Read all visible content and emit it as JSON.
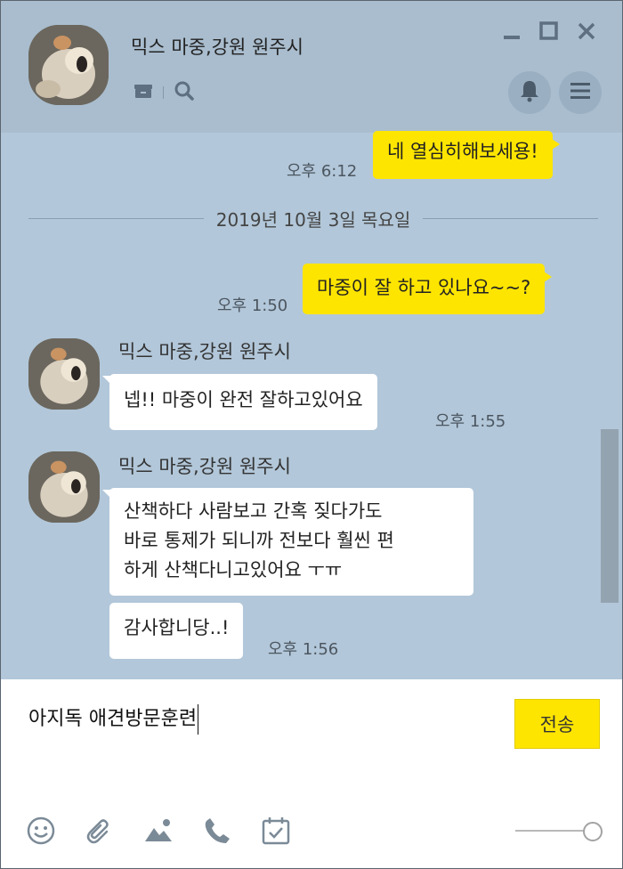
{
  "window": {
    "title": "믹스 마중,강원 원주시"
  },
  "messages": [
    {
      "type": "mine",
      "text": "네 열심히해보세용!",
      "time": "오후 6:12"
    },
    {
      "type": "date",
      "text": "2019년 10월 3일 목요일"
    },
    {
      "type": "mine",
      "text": "마중이 잘 하고 있나요~~?",
      "time": "오후 1:50"
    },
    {
      "type": "theirs",
      "sender": "믹스 마중,강원 원주시",
      "text": "넵!! 마중이 완전 잘하고있어요",
      "time": "오후 1:55"
    },
    {
      "type": "theirs",
      "sender": "믹스 마중,강원 원주시",
      "lines": [
        "산책하다 사람보고 간혹 짖다가도",
        "바로 통제가 되니까 전보다 훨씬 편",
        "하게 산책다니고있어요 ㅜㅠ"
      ]
    },
    {
      "type": "theirs",
      "text": "감사합니당..!",
      "time": "오후 1:56"
    }
  ],
  "input": {
    "value": "아지독 애견방문훈련",
    "send_label": "전송"
  },
  "icons": {
    "header": [
      "archive-icon",
      "search-icon",
      "minimize-icon",
      "maximize-icon",
      "close-icon",
      "bell-icon",
      "menu-icon"
    ],
    "toolbar": [
      "emoji-icon",
      "attachment-icon",
      "image-icon",
      "phone-icon",
      "calendar-icon"
    ]
  },
  "colors": {
    "background": "#b2c7d9",
    "my_bubble": "#fee500",
    "their_bubble": "#ffffff",
    "send_button": "#fee500"
  },
  "opacity_slider": {
    "value": 1.0
  }
}
